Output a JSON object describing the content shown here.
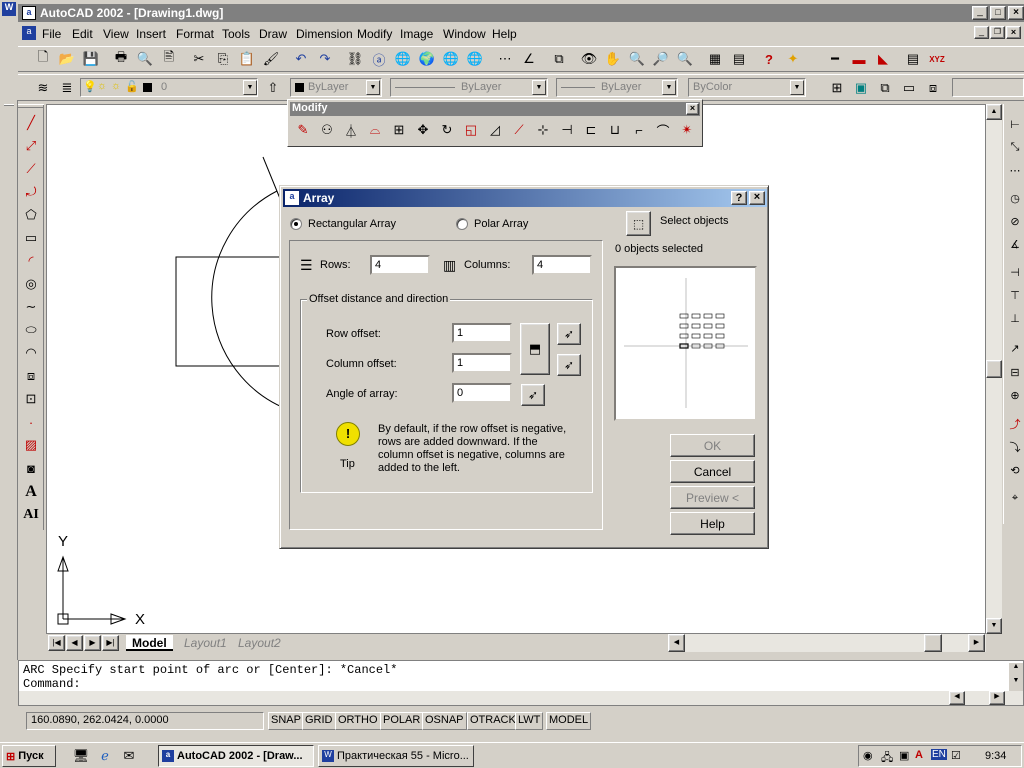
{
  "window": {
    "title": "AutoCAD 2002 - [Drawing1.dwg]"
  },
  "menu": [
    "File",
    "Edit",
    "View",
    "Insert",
    "Format",
    "Tools",
    "Draw",
    "Dimension",
    "Modify",
    "Image",
    "Window",
    "Help"
  ],
  "layer_bar": {
    "layer_value": "0",
    "color": "ByLayer",
    "linetype": "ByLayer",
    "lineweight": "ByLayer",
    "plotstyle": "ByColor"
  },
  "modify_toolbar": {
    "title": "Modify"
  },
  "dialog": {
    "title": "Array",
    "rect_label": "Rectangular Array",
    "polar_label": "Polar Array",
    "select_label": "Select objects",
    "selected_count": "0 objects selected",
    "rows_label": "Rows:",
    "rows_value": "4",
    "cols_label": "Columns:",
    "cols_value": "4",
    "group_label": "Offset distance and direction",
    "row_offset_label": "Row offset:",
    "row_offset_value": "1",
    "col_offset_label": "Column offset:",
    "col_offset_value": "1",
    "angle_label": "Angle of array:",
    "angle_value": "0",
    "tip_label": "Tip",
    "tip_text": "By default, if the row offset is negative, rows are added downward.  If the column offset is negative, columns are added to the left.",
    "ok": "OK",
    "cancel": "Cancel",
    "preview": "Preview <",
    "help": "Help"
  },
  "tabs": {
    "model": "Model",
    "layout1": "Layout1",
    "layout2": "Layout2"
  },
  "axis": {
    "x": "X",
    "y": "Y"
  },
  "command": {
    "line1": "ARC Specify start point of arc or [Center]: *Cancel*",
    "line2": "Command:"
  },
  "status": {
    "coords": "160.0890, 262.0424, 0.0000",
    "buttons": [
      "SNAP",
      "GRID",
      "ORTHO",
      "POLAR",
      "OSNAP",
      "OTRACK",
      "LWT",
      "MODEL"
    ]
  },
  "taskbar": {
    "start": "Пуск",
    "tasks": [
      "AutoCAD 2002 - [Draw...",
      "Практическая 55 - Micro..."
    ],
    "lang": "EN",
    "clock": "9:34"
  },
  "colors": {
    "title_active": "#0a246a",
    "title_active2": "#a6caf0",
    "canvas": "#ffffff"
  }
}
